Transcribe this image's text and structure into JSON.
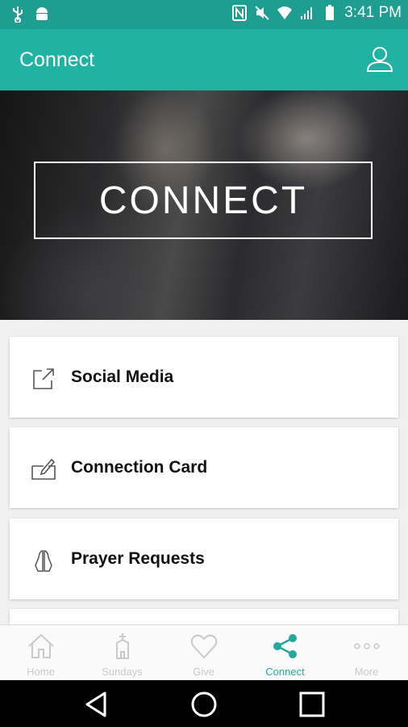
{
  "status_bar": {
    "time": "3:41 PM"
  },
  "app_bar": {
    "title": "Connect"
  },
  "hero": {
    "label": "CONNECT"
  },
  "items": [
    {
      "label": "Social Media",
      "icon": "external-link-icon"
    },
    {
      "label": "Connection Card",
      "icon": "card-edit-icon"
    },
    {
      "label": "Prayer Requests",
      "icon": "praying-hands-icon"
    }
  ],
  "tabs": [
    {
      "label": "Home",
      "icon": "home-icon"
    },
    {
      "label": "Sundays",
      "icon": "church-icon"
    },
    {
      "label": "Give",
      "icon": "heart-icon"
    },
    {
      "label": "Connect",
      "icon": "share-icon"
    },
    {
      "label": "More",
      "icon": "more-icon"
    }
  ],
  "colors": {
    "primary": "#20b2a2",
    "status_bar": "#1e9e90",
    "active_tab": "#22a999",
    "inactive_tab": "#c9c9c9"
  }
}
